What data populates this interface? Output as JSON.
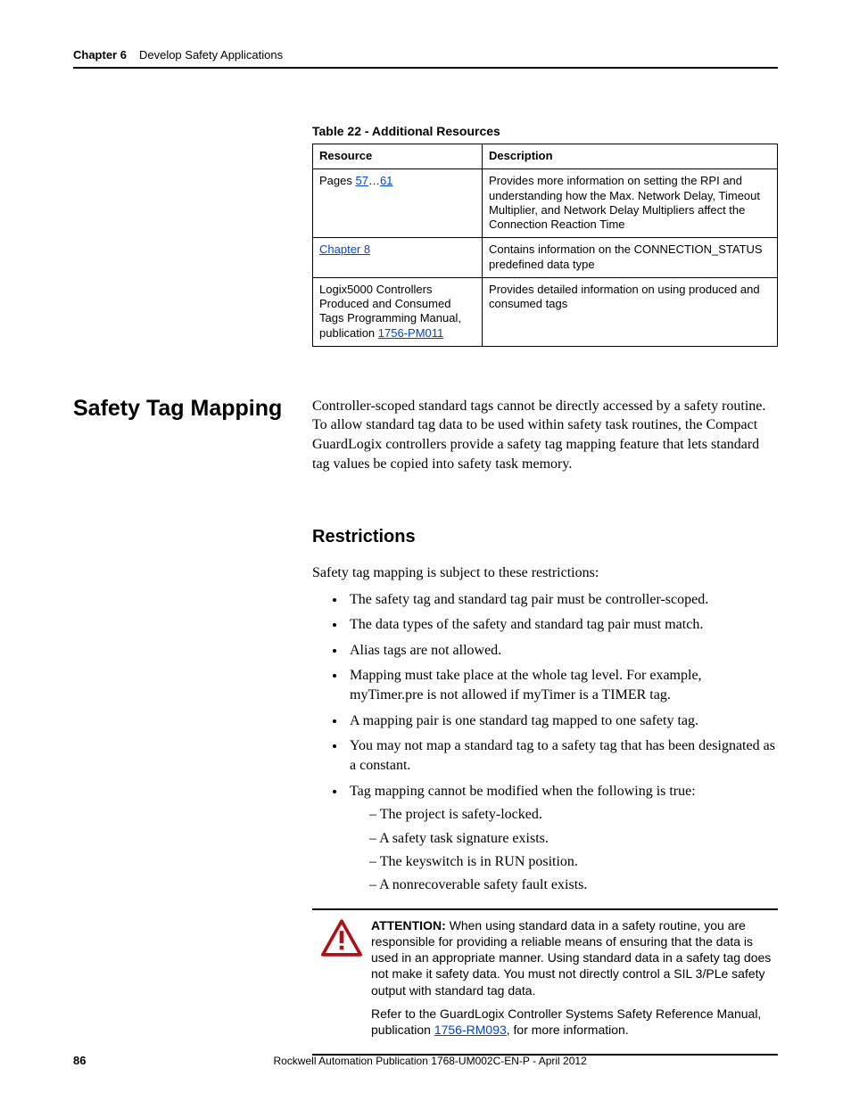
{
  "header": {
    "chapter": "Chapter 6",
    "title": "Develop Safety Applications"
  },
  "table": {
    "caption": "Table 22 - Additional Resources",
    "head": {
      "c0": "Resource",
      "c1": "Description"
    },
    "rows": [
      {
        "resource_prefix": "Pages ",
        "link1": "57",
        "mid": "…",
        "link2": "61",
        "desc": "Provides more information on setting the RPI and understanding how the Max. Network Delay, Timeout Multiplier, and Network Delay Multipliers affect the Connection Reaction Time"
      },
      {
        "link1": "Chapter 8",
        "desc": "Contains information on the CONNECTION_STATUS predefined data type"
      },
      {
        "resource_prefix": "Logix5000 Controllers Produced and Consumed Tags Programming Manual, publication ",
        "link1": "1756-PM011",
        "desc": "Provides detailed information on using produced and consumed tags"
      }
    ]
  },
  "section": {
    "heading": "Safety Tag Mapping",
    "body": "Controller-scoped standard tags cannot be directly accessed by a safety routine. To allow standard tag data to be used within safety task routines, the Compact GuardLogix controllers provide a safety tag mapping feature that lets standard tag values be copied into safety task memory."
  },
  "restrictions": {
    "heading": "Restrictions",
    "lead": "Safety tag mapping is subject to these restrictions:",
    "items": [
      "The safety tag and standard tag pair must be controller-scoped.",
      "The data types of the safety and standard tag pair must match.",
      "Alias tags are not allowed.",
      "Mapping must take place at the whole tag level. For example, myTimer.pre is not allowed if myTimer is a TIMER tag.",
      "A mapping pair is one standard tag mapped to one safety tag.",
      "You may not map a standard tag to a safety tag that has been designated as a constant.",
      "Tag mapping cannot be modified when the following is true:"
    ],
    "subitems": [
      "The project is safety-locked.",
      "A safety task signature exists.",
      "The keyswitch is in RUN position.",
      "A nonrecoverable safety fault exists."
    ]
  },
  "attention": {
    "label": "ATTENTION:",
    "p1_rest": " When using standard data in a safety routine, you are responsible for providing a reliable means of ensuring that the data is used in an appropriate manner. Using standard data in a safety tag does not make it safety data. You must not directly control a SIL 3/PLe safety output with standard tag data.",
    "p2_pre": "Refer to the GuardLogix Controller Systems Safety Reference Manual, publication ",
    "p2_link": "1756-RM093",
    "p2_post": ", for more information."
  },
  "footer": {
    "page": "86",
    "pub": "Rockwell Automation Publication 1768-UM002C-EN-P - April 2012"
  }
}
